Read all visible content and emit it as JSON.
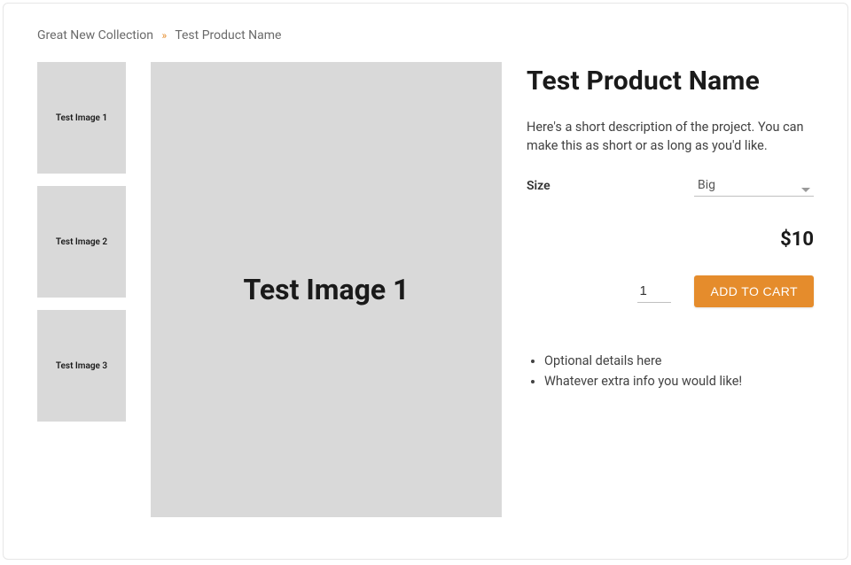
{
  "breadcrumb": {
    "collection": "Great New Collection",
    "separator": "»",
    "product": "Test Product Name"
  },
  "thumbnails": [
    {
      "label": "Test Image 1"
    },
    {
      "label": "Test Image 2"
    },
    {
      "label": "Test Image 3"
    }
  ],
  "main_image": {
    "label": "Test Image 1"
  },
  "product": {
    "title": "Test Product Name",
    "description": "Here's a short description of the project. You can make this as short or as long as you'd like.",
    "option_label": "Size",
    "option_value": "Big",
    "price": "$10",
    "quantity": "1",
    "add_to_cart_label": "ADD TO CART",
    "details": [
      "Optional details here",
      "Whatever extra info you would like!"
    ]
  }
}
